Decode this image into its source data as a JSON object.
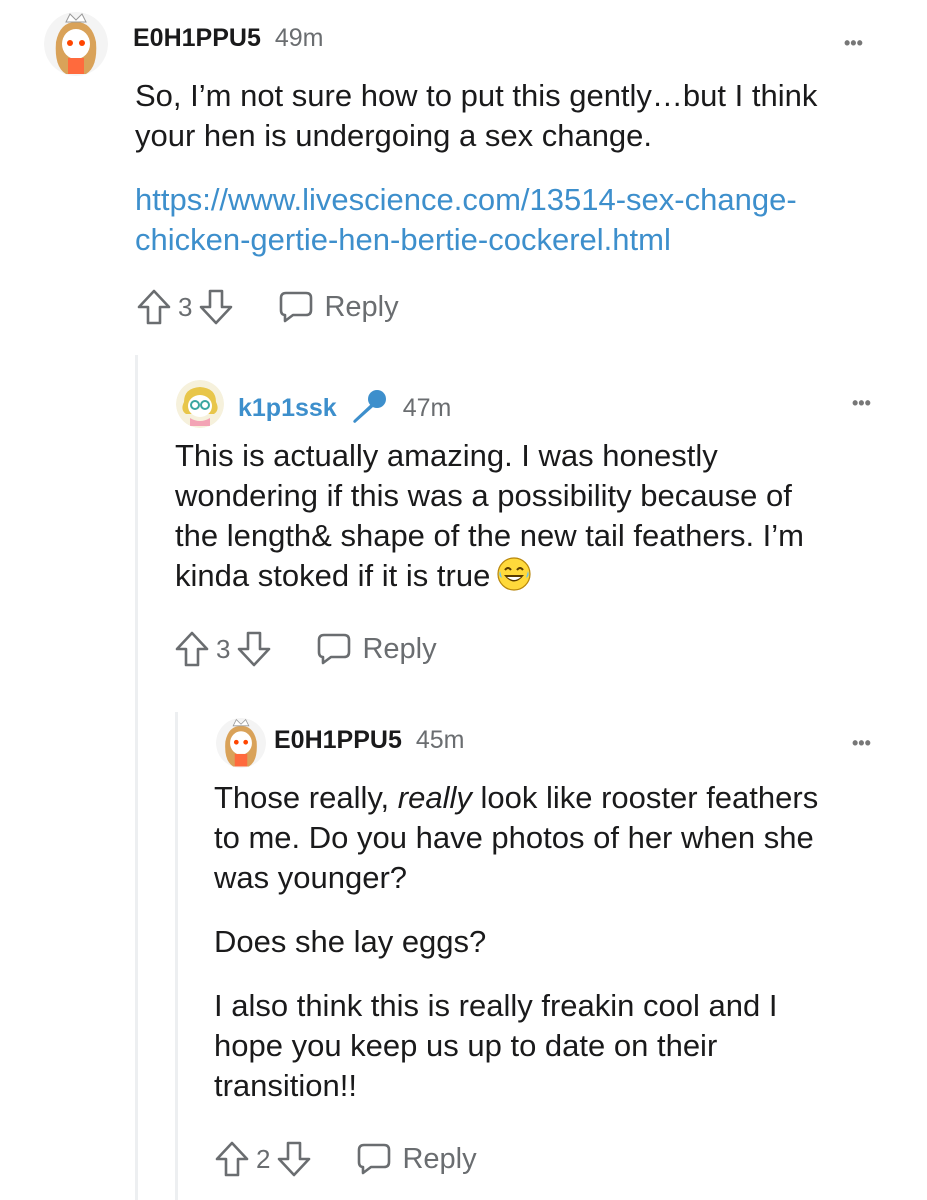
{
  "comments": [
    {
      "username": "E0H1PPU5",
      "time": "49m",
      "text1": "So, I’m not sure how to put this gently…but I think",
      "text2": "your hen is undergoing a sex change.",
      "link1": "https://www.livescience.com/13514-sex-change-",
      "link2": "chicken-gertie-hen-bertie-cockerel.html",
      "votes": "3",
      "reply_label": "Reply",
      "more_label": "•••"
    },
    {
      "username": "k1p1ssk",
      "is_op": true,
      "time": "47m",
      "line1": "This is actually amazing. I was honestly",
      "line2": "wondering if this was a possibility because of",
      "line3": "the length& shape of the new tail feathers. I’m",
      "line4": "kinda stoked if it is true",
      "votes": "3",
      "reply_label": "Reply",
      "more_label": "•••"
    },
    {
      "username": "E0H1PPU5",
      "time": "45m",
      "p1_before": "Those really, ",
      "p1_em": "really",
      "p1_after": " look like rooster feathers",
      "p1_line2": "to me. Do you have photos of her when she",
      "p1_line3": "was younger?",
      "p2": "Does she lay eggs?",
      "p3_line1": "I also think this is really freakin cool and I",
      "p3_line2": "hope you keep us up to date on their",
      "p3_line3": "transition!!",
      "votes": "2",
      "reply_label": "Reply",
      "more_label": "•••"
    }
  ],
  "icons": {
    "upvote": "upvote-arrow-icon",
    "downvote": "downvote-arrow-icon",
    "reply": "speech-bubble-icon",
    "op_badge": "microphone-icon",
    "emoji": "laughing-emoji-icon"
  },
  "colors": {
    "link": "#3d8fcc",
    "op_username": "#3d8fcc",
    "meta": "#6a6d70",
    "text": "#1a1a1b"
  }
}
